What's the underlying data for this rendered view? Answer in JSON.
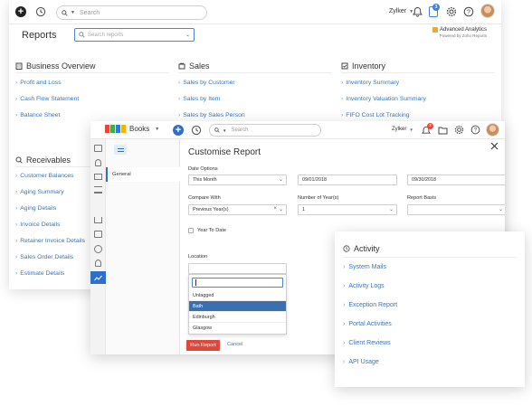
{
  "back": {
    "search_placeholder": "Search",
    "org_name": "Zylker",
    "notification_count": "3",
    "page_title": "Reports",
    "search_reports_placeholder": "Search reports",
    "advanced_title": "Advanced Analytics",
    "advanced_sub": "Powered by Zoho Reports",
    "sections": [
      {
        "title": "Business Overview",
        "items": [
          "Profit and Loss",
          "Cash Flow Statement",
          "Balance Sheet"
        ]
      },
      {
        "title": "Sales",
        "items": [
          "Sales by Customer",
          "Sales by Item",
          "Sales by Sales Person"
        ]
      },
      {
        "title": "Inventory",
        "items": [
          "Inventory Summary",
          "Inventory Valuation Summary",
          "FIFO Cost Lot Tracking"
        ]
      }
    ],
    "receivables": {
      "title": "Receivables",
      "items": [
        "Customer Balances",
        "Aging Summary",
        "Aging Details",
        "Invoice Details",
        "Retainer Invoice Details",
        "Sales Order Details",
        "Estimate Details"
      ]
    }
  },
  "front": {
    "logo_word": "ZOHO",
    "app_name": "Books",
    "search_placeholder": "Search",
    "org_name": "Zylker",
    "notification_count": "2",
    "dialog_title": "Customise Report",
    "nav_general": "General",
    "date_options_label": "Date Options",
    "date_option_value": "This Month",
    "start_date": "09/01/2018",
    "end_date": "09/30/2018",
    "compare_label": "Compare With",
    "compare_value": "Previous Year(s)",
    "years_label": "Number of Year(s)",
    "years_value": "1",
    "basis_label": "Report Basis",
    "basis_value": "",
    "ytd_label": "Year To Date",
    "location_label": "Location",
    "location_options": [
      "Untagged",
      "Bath",
      "Edinburgh",
      "Glasgow"
    ],
    "location_selected": "Bath",
    "run_button": "Run Report",
    "cancel_button": "Cancel"
  },
  "activity": {
    "title": "Activity",
    "items": [
      "System Mails",
      "Activity Logs",
      "Exception Report",
      "Portal Activities",
      "Client Reviews",
      "API Usage"
    ]
  },
  "colors": {
    "link": "#3a76b8",
    "primary_blue": "#2f6fc7",
    "run_red": "#e0463a",
    "notif_blue": "#3a82e8",
    "notif_red": "#e8453c"
  }
}
